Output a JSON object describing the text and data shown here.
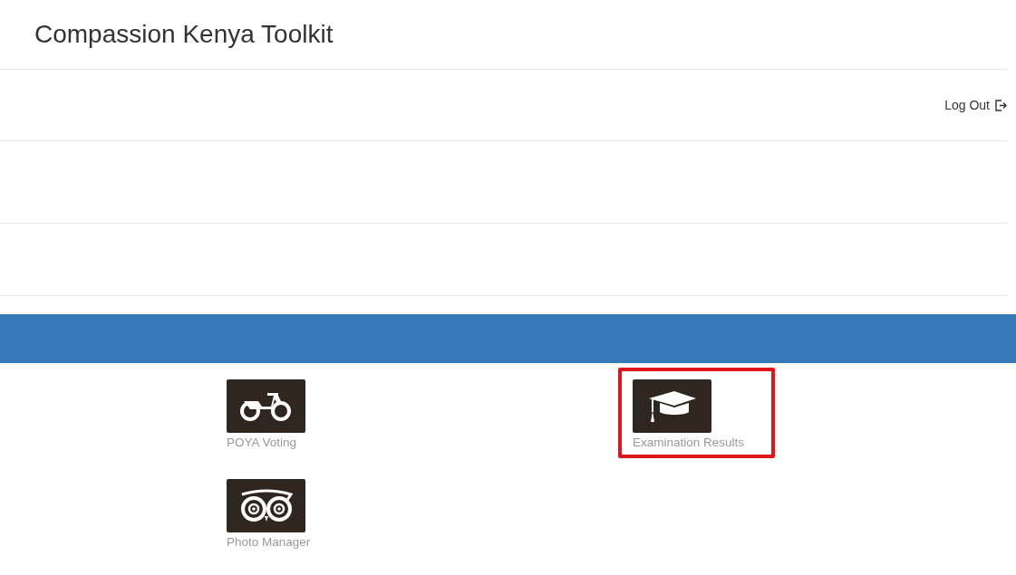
{
  "header": {
    "title": "Compassion Kenya Toolkit"
  },
  "nav": {
    "logout": "Log Out"
  },
  "tiles": [
    {
      "kind": "motorcycle",
      "label": "POYA Voting",
      "highlighted": false
    },
    {
      "kind": "graduation",
      "label": "Examination Results",
      "highlighted": true
    },
    {
      "kind": "owl",
      "label": "Photo Manager",
      "highlighted": false
    }
  ]
}
